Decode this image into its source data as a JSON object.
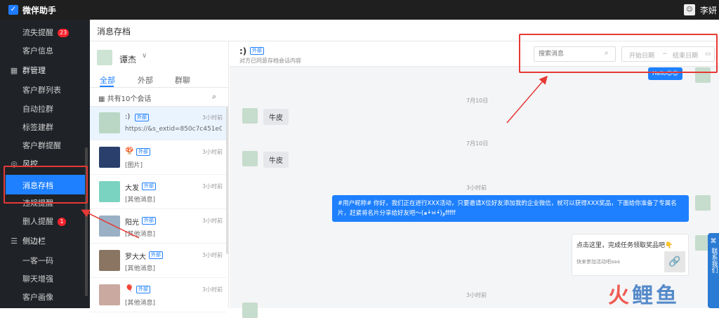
{
  "app": {
    "logo_glyph": "✓",
    "title": "微伴助手",
    "user_avatar_glyph": "☺",
    "user_name": "李妍"
  },
  "sidebar": {
    "items": [
      {
        "label": "流失提醒",
        "badge": "23"
      },
      {
        "label": "客户信息"
      },
      {
        "label": "群管理",
        "icon": "grid-icon",
        "glyph": "▦"
      },
      {
        "label": "客户群列表"
      },
      {
        "label": "自动拉群"
      },
      {
        "label": "标签建群"
      },
      {
        "label": "客户群提醒"
      },
      {
        "label": "风控",
        "icon": "shield-icon",
        "glyph": "◎"
      },
      {
        "label": "消息存档"
      },
      {
        "label": "违规提醒"
      },
      {
        "label": "删人提醒",
        "badge": "1"
      },
      {
        "label": "侧边栏",
        "icon": "sidebar-icon",
        "glyph": "☰"
      },
      {
        "label": "一客一码"
      },
      {
        "label": "聊天增强"
      },
      {
        "label": "客户画像"
      }
    ]
  },
  "main": {
    "title": "消息存档"
  },
  "contacts": {
    "owner": "谭杰",
    "caret": "∨",
    "tabs": [
      "全部",
      "外部",
      "群聊"
    ],
    "count_label": "共有10个会话",
    "count_icon_glyph": "▦",
    "search_icon_glyph": "⌕",
    "list": [
      {
        "name": ":)",
        "tag": "外部",
        "time": "3小时前",
        "msg": "https://&s_extid=850c7c451e0c6b..."
      },
      {
        "name": "🍄",
        "tag": "外部",
        "time": "3小时前",
        "msg": "[图片]"
      },
      {
        "name": "大发",
        "tag": "外部",
        "time": "3小时前",
        "msg": "[其他消息]"
      },
      {
        "name": "阳光",
        "tag": "外部",
        "time": "3小时前",
        "msg": "[其他消息]"
      },
      {
        "name": "罗大大",
        "tag": "外部",
        "time": "3小时前",
        "msg": "[其他消息]"
      },
      {
        "name": "🎈",
        "tag": "外部",
        "time": "3小时前",
        "msg": "[其他消息]"
      }
    ]
  },
  "chat": {
    "title": ":)",
    "tag": "外部",
    "subtitle": "对方已同意存档会话内容",
    "search_placeholder": "搜索消息",
    "search_icon_glyph": "⌕",
    "date_start": "开始日期",
    "date_sep": "~",
    "date_end": "结束日期",
    "calendar_icon_glyph": "▭",
    "top_partial": "Hello😊😊",
    "messages": [
      {
        "date": "7月10日",
        "text": "牛皮"
      },
      {
        "date": "7月10日",
        "text": "牛皮"
      },
      {
        "date": "3小时前",
        "text": "#用户昵称# 你好，我们正在进行XXX活动，只要邀请X位好友添加我的企业微信，就可以获得XXX奖品，下面给你准备了专属名片，赶紧将名片分享给好友吧～(๑•̀ㅂ•́)وfffff"
      },
      {
        "date": "3小时前"
      }
    ],
    "card_title": "点击这里，完成任务领取奖品吧👇",
    "card_sub": "快来参加活动吧aaa",
    "card_img_glyph": "🔗"
  },
  "float_tab": {
    "glyph": "⌘",
    "label": "联系我们"
  },
  "watermark": {
    "text_a": "火",
    "text_b": "鲤",
    "text_c": "鱼"
  },
  "colors": {
    "primary": "#1e80ff",
    "sidebar_bg": "#1f2227",
    "highlight": "#e53935",
    "badge": "#f5222d"
  }
}
